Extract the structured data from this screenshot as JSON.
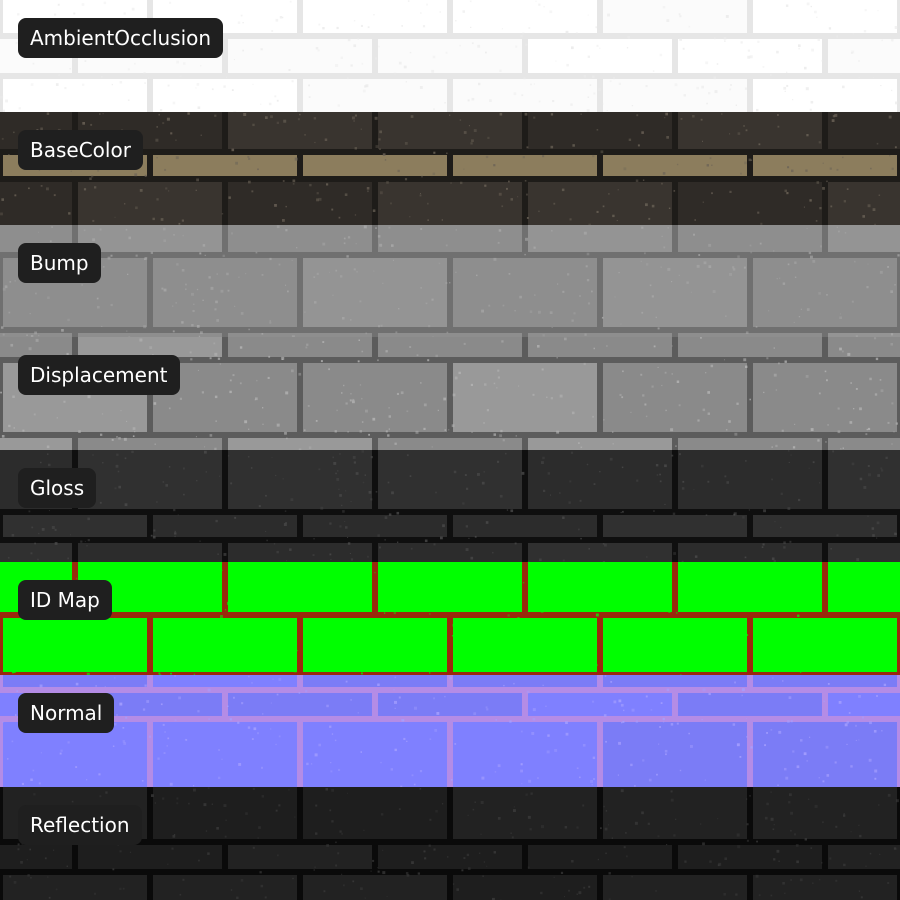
{
  "maps": [
    {
      "label": "AmbientOcclusion",
      "base": "#fbfbfb",
      "mortar": "#e6e6e6",
      "tone_a": "#ffffff",
      "tone_b": "#f2f2f2",
      "speckle": "#eaeaea"
    },
    {
      "label": "BaseColor",
      "base": "#39342f",
      "mortar": "#1e1c19",
      "tone_a": "#2f2b27",
      "tone_b": "#8c7d5d",
      "speckle": "#6b6357"
    },
    {
      "label": "Bump",
      "base": "#8e8e8e",
      "mortar": "#707070",
      "tone_a": "#949494",
      "tone_b": "#7f7f7f",
      "speckle": "#a9a9a9"
    },
    {
      "label": "Displacement",
      "base": "#8a8a8a",
      "mortar": "#5c5c5c",
      "tone_a": "#999999",
      "tone_b": "#7d7d7d",
      "speckle": "#b4b4b4"
    },
    {
      "label": "Gloss",
      "base": "#2c2c2c",
      "mortar": "#0f0f0f",
      "tone_a": "#303030",
      "tone_b": "#262626",
      "speckle": "#4a4a4a"
    },
    {
      "label": "ID Map",
      "base": "#00ff00",
      "mortar": "#9a2a0c",
      "tone_a": "#00ff00",
      "tone_b": "#00f000",
      "speckle": "#00ff00"
    },
    {
      "label": "Normal",
      "base": "#7f80ff",
      "mortar": "#b48ce6",
      "tone_a": "#7b7cf6",
      "tone_b": "#8b8cff",
      "speckle": "#a6a0ff"
    },
    {
      "label": "Reflection",
      "base": "#1e1e1e",
      "mortar": "#0a0a0a",
      "tone_a": "#222222",
      "tone_b": "#1a1a1a",
      "speckle": "#3a3a3a"
    }
  ]
}
